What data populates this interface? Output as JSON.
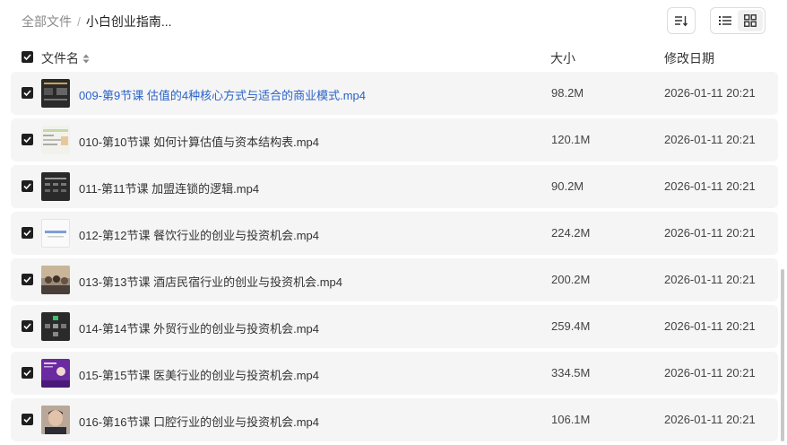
{
  "breadcrumb": {
    "root": "全部文件",
    "separator": "/",
    "current": "小白创业指南..."
  },
  "toolbar": {
    "sort_icon": "sort-descending-icon",
    "list_icon": "list-view-icon",
    "grid_icon": "grid-view-icon"
  },
  "header": {
    "name": "文件名",
    "size": "大小",
    "date": "修改日期"
  },
  "colors": {
    "row_background": "#f5f5f5",
    "link_blue": "#2a62c9",
    "checkbox": "#1f1f1f"
  },
  "files": [
    {
      "name": "009-第9节课 估值的4种核心方式与适合的商业模式.mp4",
      "size": "98.2M",
      "date": "2026-01-11 20:21",
      "checked": true,
      "highlighted": true
    },
    {
      "name": "010-第10节课 如何计算估值与资本结构表.mp4",
      "size": "120.1M",
      "date": "2026-01-11 20:21",
      "checked": true
    },
    {
      "name": "011-第11节课 加盟连锁的逻辑.mp4",
      "size": "90.2M",
      "date": "2026-01-11 20:21",
      "checked": true
    },
    {
      "name": "012-第12节课 餐饮行业的创业与投资机会.mp4",
      "size": "224.2M",
      "date": "2026-01-11 20:21",
      "checked": true
    },
    {
      "name": "013-第13节课 酒店民宿行业的创业与投资机会.mp4",
      "size": "200.2M",
      "date": "2026-01-11 20:21",
      "checked": true
    },
    {
      "name": "014-第14节课 外贸行业的创业与投资机会.mp4",
      "size": "259.4M",
      "date": "2026-01-11 20:21",
      "checked": true
    },
    {
      "name": "015-第15节课 医美行业的创业与投资机会.mp4",
      "size": "334.5M",
      "date": "2026-01-11 20:21",
      "checked": true
    },
    {
      "name": "016-第16节课 口腔行业的创业与投资机会.mp4",
      "size": "106.1M",
      "date": "2026-01-11 20:21",
      "checked": true
    }
  ]
}
